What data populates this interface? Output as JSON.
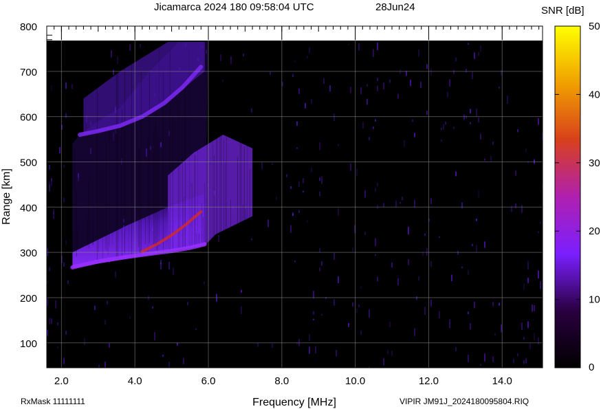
{
  "chart_data": {
    "type": "heatmap",
    "title": "Jicamarca 2024 180 09:58:04 UTC",
    "date_label": "28Jun24",
    "xlabel": "Frequency [MHz]",
    "ylabel": "Range [km]",
    "xlim": [
      1.6,
      15.1
    ],
    "ylim": [
      45,
      800
    ],
    "x_ticks": [
      "2.0",
      "4.0",
      "6.0",
      "8.0",
      "10.0",
      "12.0",
      "14.0"
    ],
    "y_ticks": [
      "100",
      "200",
      "300",
      "400",
      "500",
      "600",
      "700",
      "800"
    ],
    "colorbar": {
      "label": "SNR [dB]",
      "range": [
        0,
        50
      ],
      "ticks": [
        "0",
        "10",
        "20",
        "30",
        "40",
        "50"
      ],
      "stops": [
        "#000000",
        "#2a0040",
        "#7a1fff",
        "#b020b0",
        "#d8401c",
        "#f0a000",
        "#ffff00"
      ]
    },
    "data_max_range_km": 765,
    "echo_traces": [
      {
        "name": "",
        "points": [
          [
            2.3,
            267
          ],
          [
            3.0,
            280
          ],
          [
            3.8,
            290
          ],
          [
            4.5,
            298
          ],
          [
            5.0,
            303
          ],
          [
            5.5,
            310
          ],
          [
            5.9,
            318
          ]
        ],
        "snr_db": 18
      },
      {
        "name": "",
        "points": [
          [
            4.2,
            302
          ],
          [
            4.6,
            318
          ],
          [
            5.0,
            338
          ],
          [
            5.4,
            362
          ],
          [
            5.8,
            390
          ]
        ],
        "snr_db": 25
      },
      {
        "name": "",
        "points": [
          [
            2.5,
            560
          ],
          [
            3.0,
            568
          ],
          [
            3.6,
            580
          ],
          [
            4.2,
            600
          ],
          [
            4.8,
            630
          ],
          [
            5.3,
            665
          ],
          [
            5.8,
            710
          ]
        ],
        "snr_db": 12
      }
    ],
    "footer_left": "RxMask 11111111",
    "footer_right": "VIPIR  JM91J_2024180095804.RIQ"
  }
}
